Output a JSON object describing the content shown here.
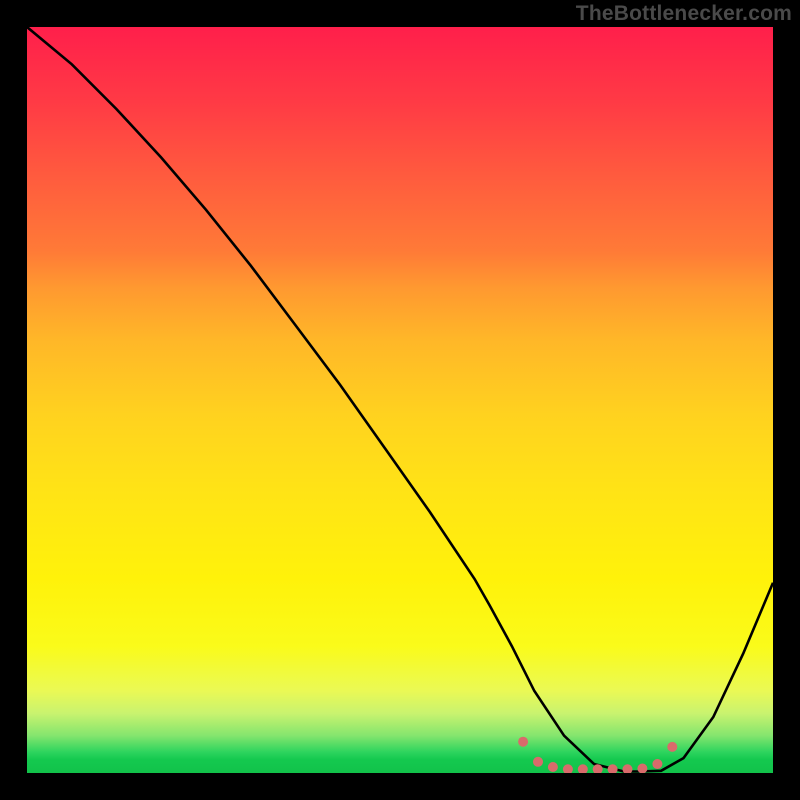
{
  "watermark": "TheBottlenecker.com",
  "chart_data": {
    "type": "line",
    "title": "",
    "xlabel": "",
    "ylabel": "",
    "xlim": [
      0,
      100
    ],
    "ylim": [
      0,
      100
    ],
    "series": [
      {
        "name": "bottleneck-curve",
        "x": [
          0,
          6,
          12,
          18,
          24,
          30,
          36,
          42,
          48,
          54,
          60,
          62,
          65,
          68,
          72,
          76,
          80,
          82,
          85,
          88,
          92,
          96,
          100
        ],
        "y": [
          100,
          95,
          89,
          82.5,
          75.5,
          68,
          60,
          52,
          43.5,
          35,
          26,
          22.5,
          17,
          11,
          5,
          1.2,
          0.2,
          0.2,
          0.3,
          2,
          7.5,
          16,
          25.5
        ]
      }
    ],
    "markers": {
      "name": "scatter-points",
      "color": "#d96b6b",
      "radius_px": 5,
      "x": [
        66.5,
        68.5,
        70.5,
        72.5,
        74.5,
        76.5,
        78.5,
        80.5,
        82.5,
        84.5,
        86.5
      ],
      "y": [
        4.2,
        1.5,
        0.8,
        0.5,
        0.5,
        0.5,
        0.5,
        0.5,
        0.6,
        1.2,
        3.5
      ]
    }
  }
}
